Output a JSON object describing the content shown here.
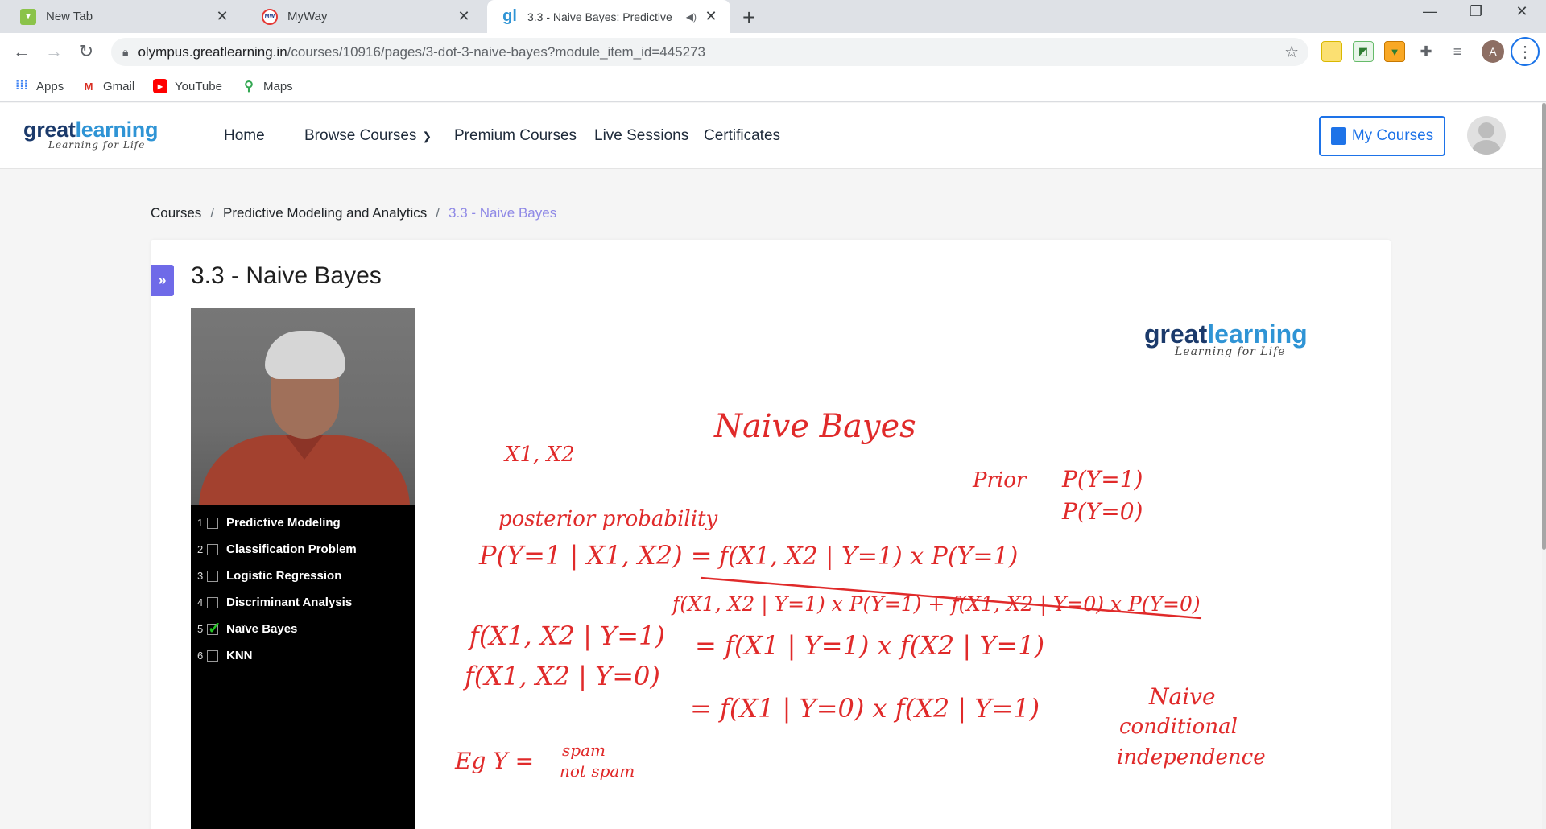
{
  "browser": {
    "tabs": [
      {
        "title": "New Tab",
        "icon": "new-tab-favicon",
        "active": false
      },
      {
        "title": "MyWay",
        "icon": "myway-favicon",
        "active": false
      },
      {
        "title": "3.3 - Naive Bayes: Predictive",
        "icon": "greatlearning-favicon",
        "active": true,
        "audio": true
      }
    ],
    "url_host": "olympus.greatlearning.in",
    "url_path": "/courses/10916/pages/3-dot-3-naive-bayes?module_item_id=445273",
    "profile_initial": "A",
    "bookmarks": [
      {
        "label": "Apps",
        "icon": "apps-grid-icon"
      },
      {
        "label": "Gmail",
        "icon": "gmail-icon"
      },
      {
        "label": "YouTube",
        "icon": "youtube-icon"
      },
      {
        "label": "Maps",
        "icon": "maps-icon"
      }
    ]
  },
  "site": {
    "logo": {
      "part1": "great",
      "part2": "learning",
      "tagline": "Learning for Life"
    },
    "nav": [
      "Home",
      "Browse Courses",
      "Premium Courses",
      "Live Sessions",
      "Certificates"
    ],
    "my_courses": "My Courses"
  },
  "breadcrumb": [
    "Courses",
    "Predictive Modeling and Analytics",
    "3.3 - Naive Bayes"
  ],
  "page_title": "3.3 - Naive Bayes",
  "video": {
    "topics": [
      {
        "num": "1",
        "label": "Predictive Modeling",
        "done": false
      },
      {
        "num": "2",
        "label": "Classification Problem",
        "done": false
      },
      {
        "num": "3",
        "label": "Logistic Regression",
        "done": false
      },
      {
        "num": "4",
        "label": "Discriminant Analysis",
        "done": false
      },
      {
        "num": "5",
        "label": "Naïve Bayes",
        "done": true
      },
      {
        "num": "6",
        "label": "KNN",
        "done": false
      }
    ],
    "board_logo": {
      "part1": "great",
      "part2": "learning",
      "tagline": "Learning for Life"
    },
    "whiteboard": {
      "heading": "Naive Bayes",
      "vars": "X1, X2",
      "prior_label": "Prior",
      "prior_1": "P(Y=1)",
      "prior_0": "P(Y=0)",
      "posterior_label": "posterior probability",
      "posterior_lhs": "P(Y=1 | X1, X2)  =",
      "numerator": "f(X1, X2 | Y=1) x P(Y=1)",
      "denominator": "f(X1, X2 | Y=1) x P(Y=1) + f(X1, X2 | Y=0) x P(Y=0)",
      "lik1_lhs": "f(X1, X2 | Y=1)",
      "lik1_rhs": "= f(X1 | Y=1) x f(X2 | Y=1)",
      "lik0_lhs": "f(X1, X2 | Y=0)",
      "lik0_rhs": "= f(X1 | Y=0) x f(X2 | Y=1)",
      "eg": "Eg   Y =",
      "eg_opt1": "spam",
      "eg_opt2": "not spam",
      "note1": "Naive",
      "note2": "conditional",
      "note3": "independence"
    }
  },
  "colors": {
    "accent": "#6f6ae8",
    "primary_blue": "#1e73e8",
    "ink_red": "#e02a2a",
    "check_green": "#22c322"
  }
}
